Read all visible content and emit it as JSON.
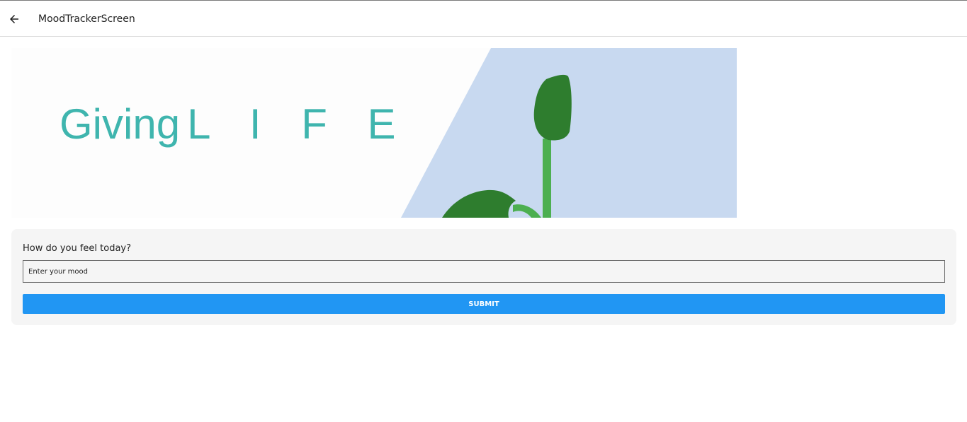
{
  "header": {
    "title": "MoodTrackerScreen",
    "back_icon": "arrow-left-icon"
  },
  "banner": {
    "text_word": "Giving",
    "text_spaced": "L I F E",
    "text_color": "#3fb5ae",
    "panel_color": "#c8d9f0",
    "plant_color": "#2e7d2e"
  },
  "mood_card": {
    "question": "How do you feel today?",
    "input_placeholder": "Enter your mood",
    "input_value": "",
    "submit_label": "SUBMIT",
    "submit_color": "#2196f3"
  }
}
